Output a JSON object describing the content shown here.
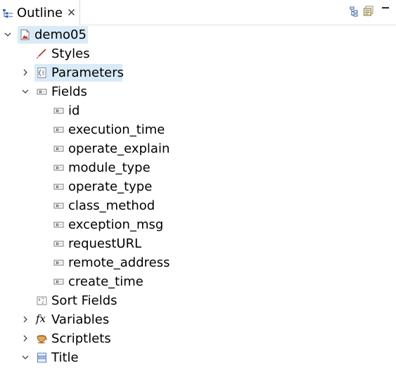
{
  "tab": {
    "title": "Outline",
    "icon": "outline-icon",
    "close_icon": "close-icon"
  },
  "toolbar": {
    "icons": [
      "link-icon",
      "collapse-all-icon",
      "view-menu-icon"
    ]
  },
  "colors": {
    "selection": "#d9ebf9",
    "twisty": "#444444",
    "field_icon": "#7a7a7a"
  },
  "tree": {
    "root": {
      "label": "demo05",
      "icon": "report-icon",
      "expanded": true,
      "selected": true
    },
    "styles": {
      "label": "Styles",
      "icon": "brush-icon"
    },
    "parameters": {
      "label": "Parameters",
      "icon": "parameters-icon",
      "expanded": false,
      "hovered": true
    },
    "fields": {
      "label": "Fields",
      "icon": "field-icon",
      "expanded": true,
      "children": [
        "id",
        "execution_time",
        "operate_explain",
        "module_type",
        "operate_type",
        "class_method",
        "exception_msg",
        "requestURL",
        "remote_address",
        "create_time"
      ]
    },
    "sort_fields": {
      "label": "Sort Fields",
      "icon": "sort-icon"
    },
    "variables": {
      "label": "Variables",
      "icon": "function-icon",
      "glyph": "fx",
      "expanded": false
    },
    "scriptlets": {
      "label": "Scriptlets",
      "icon": "cup-icon",
      "expanded": false
    },
    "title": {
      "label": "Title",
      "icon": "band-icon",
      "expanded": true
    }
  }
}
